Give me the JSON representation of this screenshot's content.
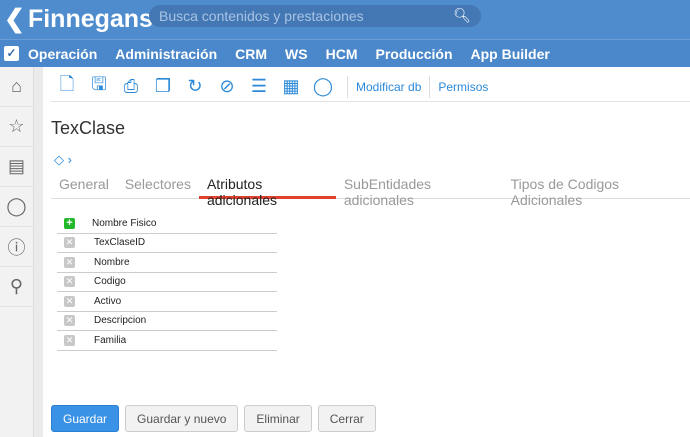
{
  "header": {
    "logo": "Finnegans",
    "search_placeholder": "Busca contenidos y prestaciones"
  },
  "nav": {
    "items": [
      "Operación",
      "Administración",
      "CRM",
      "WS",
      "HCM",
      "Producción",
      "App Builder"
    ]
  },
  "sidebar": {
    "icons": [
      "home-icon",
      "star-icon",
      "clipboard-icon",
      "chat-icon",
      "help-icon",
      "user-search-icon"
    ]
  },
  "toolbar": {
    "icons": [
      "new-document-icon",
      "save-icon",
      "print-icon",
      "copy-icon",
      "history-icon",
      "attachment-icon",
      "checklist-icon",
      "report-icon",
      "comment-icon"
    ],
    "links": [
      "Modificar db",
      "Permisos"
    ]
  },
  "page": {
    "title": "TexClase"
  },
  "tabs": [
    {
      "label": "General"
    },
    {
      "label": "Selectores"
    },
    {
      "label": "Atributos adicionales",
      "active": true
    },
    {
      "label": "SubEntidades adicionales"
    },
    {
      "label": "Tipos de Codigos Adicionales"
    }
  ],
  "grid": {
    "header": "Nombre Fisico",
    "rows": [
      "TexClaseID",
      "Nombre",
      "Codigo",
      "Activo",
      "Descripcion",
      "Familia"
    ]
  },
  "buttons": {
    "save": "Guardar",
    "save_new": "Guardar y nuevo",
    "delete": "Eliminar",
    "close": "Cerrar"
  },
  "colors": {
    "brand": "#4e8cce",
    "accent": "#2c89d9",
    "active_tab": "#e0412f"
  }
}
